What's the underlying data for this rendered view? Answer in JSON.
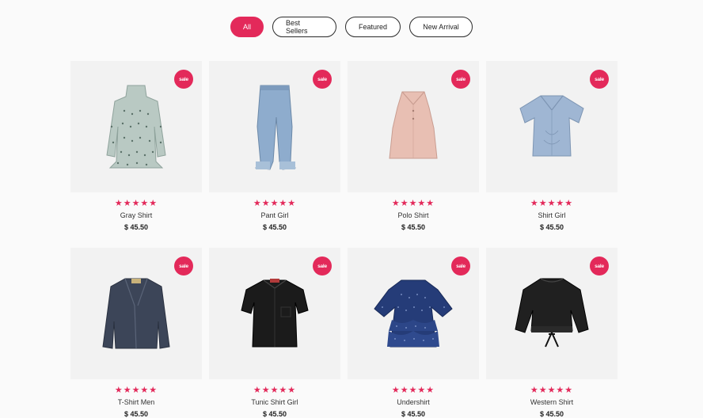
{
  "filters": [
    {
      "label": "All",
      "active": true
    },
    {
      "label": "Best Sellers",
      "active": false
    },
    {
      "label": "Featured",
      "active": false
    },
    {
      "label": "New Arrival",
      "active": false
    }
  ],
  "products": [
    {
      "name": "Gray Shirt",
      "price": "$ 45.50",
      "badge": "sale",
      "rating": 5,
      "stars": "★★★★★",
      "icon": "blouse-icon"
    },
    {
      "name": "Pant Girl",
      "price": "$ 45.50",
      "badge": "sale",
      "rating": 5,
      "stars": "★★★★★",
      "icon": "jeans-icon"
    },
    {
      "name": "Polo Shirt",
      "price": "$ 45.50",
      "badge": "sale",
      "rating": 5,
      "stars": "★★★★★",
      "icon": "halter-top-icon"
    },
    {
      "name": "Shirt Girl",
      "price": "$ 45.50",
      "badge": "sale",
      "rating": 5,
      "stars": "★★★★★",
      "icon": "crop-top-icon"
    },
    {
      "name": "T-Shirt Men",
      "price": "$ 45.50",
      "badge": "sale",
      "rating": 5,
      "stars": "★★★★★",
      "icon": "blazer-icon"
    },
    {
      "name": "Tunic Shirt Girl",
      "price": "$ 45.50",
      "badge": "sale",
      "rating": 5,
      "stars": "★★★★★",
      "icon": "black-shirt-icon"
    },
    {
      "name": "Undershirt",
      "price": "$ 45.50",
      "badge": "sale",
      "rating": 5,
      "stars": "★★★★★",
      "icon": "ruffle-top-icon"
    },
    {
      "name": "Western Shirt",
      "price": "$ 45.50",
      "badge": "sale",
      "rating": 5,
      "stars": "★★★★★",
      "icon": "batwing-top-icon"
    }
  ],
  "colors": {
    "accent": "#e3295a",
    "card_bg": "#f2f2f2",
    "page_bg": "#fafafa"
  }
}
